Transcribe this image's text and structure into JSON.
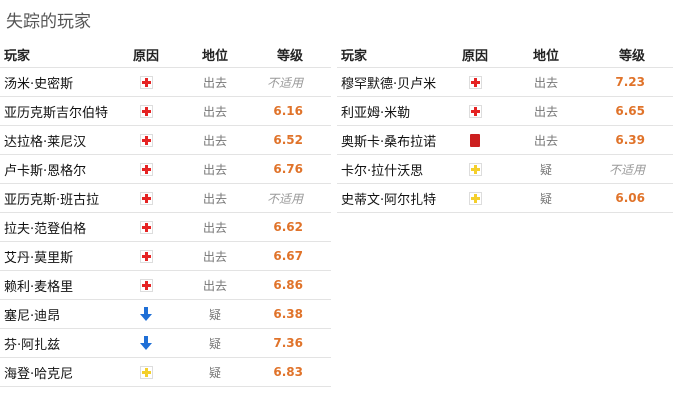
{
  "title": "失踪的玩家",
  "headers": {
    "player": "玩家",
    "reason": "原因",
    "status": "地位",
    "rating": "等级"
  },
  "colors": {
    "rating": "#e0732a",
    "injury": "#e52323",
    "doubtful": "#f4cf2b",
    "red_card": "#cc1f1f",
    "down_arrow": "#1f6fd6"
  },
  "left_rows": [
    {
      "player": "汤米·史密斯",
      "reason_icon": "injury-icon",
      "status": "出去",
      "rating": "不适用"
    },
    {
      "player": "亚历克斯吉尔伯特",
      "reason_icon": "injury-icon",
      "status": "出去",
      "rating": "6.16"
    },
    {
      "player": "达拉格·莱尼汉",
      "reason_icon": "injury-icon",
      "status": "出去",
      "rating": "6.52"
    },
    {
      "player": "卢卡斯·恩格尔",
      "reason_icon": "injury-icon",
      "status": "出去",
      "rating": "6.76"
    },
    {
      "player": "亚历克斯·班古拉",
      "reason_icon": "injury-icon",
      "status": "出去",
      "rating": "不适用"
    },
    {
      "player": "拉夫·范登伯格",
      "reason_icon": "injury-icon",
      "status": "出去",
      "rating": "6.62"
    },
    {
      "player": "艾丹·莫里斯",
      "reason_icon": "injury-icon",
      "status": "出去",
      "rating": "6.67"
    },
    {
      "player": "赖利·麦格里",
      "reason_icon": "injury-icon",
      "status": "出去",
      "rating": "6.86"
    },
    {
      "player": "塞尼·迪昂",
      "reason_icon": "down-arrow-icon",
      "status": "疑",
      "rating": "6.38"
    },
    {
      "player": "芬·阿扎兹",
      "reason_icon": "down-arrow-icon",
      "status": "疑",
      "rating": "7.36"
    },
    {
      "player": "海登·哈克尼",
      "reason_icon": "doubtful-icon",
      "status": "疑",
      "rating": "6.83"
    }
  ],
  "right_rows": [
    {
      "player": "穆罕默德·贝卢米",
      "reason_icon": "injury-icon",
      "status": "出去",
      "rating": "7.23"
    },
    {
      "player": "利亚姆·米勒",
      "reason_icon": "injury-icon",
      "status": "出去",
      "rating": "6.65"
    },
    {
      "player": "奥斯卡·桑布拉诺",
      "reason_icon": "red-card-icon",
      "status": "出去",
      "rating": "6.39"
    },
    {
      "player": "卡尔·拉什沃思",
      "reason_icon": "doubtful-icon",
      "status": "疑",
      "rating": "不适用"
    },
    {
      "player": "史蒂文·阿尔扎特",
      "reason_icon": "doubtful-icon",
      "status": "疑",
      "rating": "6.06"
    }
  ]
}
